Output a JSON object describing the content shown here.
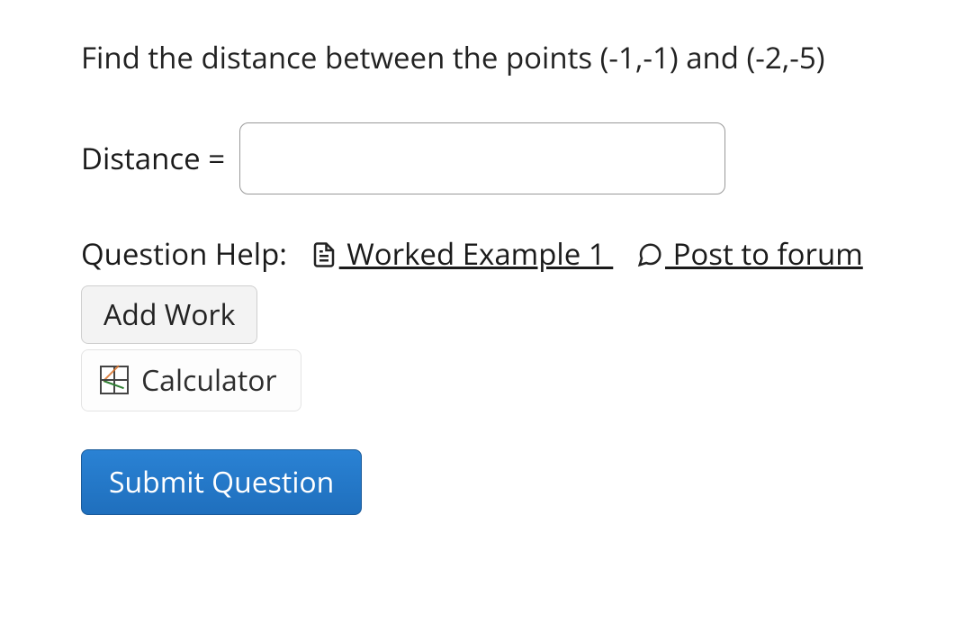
{
  "question": {
    "prompt": "Find the distance between the points (-1,-1) and (-2,-5)",
    "answer_label": "Distance =",
    "answer_value": ""
  },
  "help": {
    "label": "Question Help:",
    "links": [
      {
        "icon": "file-icon",
        "text": " Worked Example 1 "
      },
      {
        "icon": "comment-icon",
        "text": " Post to forum"
      }
    ]
  },
  "buttons": {
    "add_work": "Add Work",
    "calculator": "Calculator",
    "submit": "Submit Question"
  }
}
